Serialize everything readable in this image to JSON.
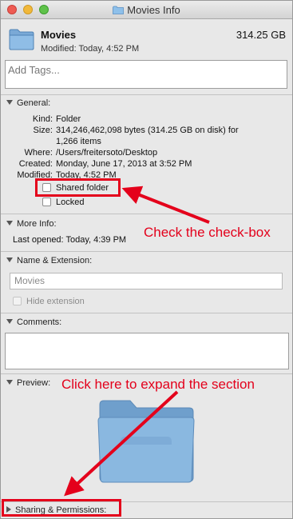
{
  "window": {
    "title": "Movies Info"
  },
  "header": {
    "name": "Movies",
    "size": "314.25 GB",
    "modified": "Modified: Today, 4:52 PM"
  },
  "tags": {
    "placeholder": "Add Tags..."
  },
  "general": {
    "heading": "General:",
    "kind_label": "Kind:",
    "kind_value": "Folder",
    "size_label": "Size:",
    "size_value_1": "314,246,462,098 bytes (314.25 GB on disk) for",
    "size_value_2": "1,266 items",
    "where_label": "Where:",
    "where_value": "/Users/freitersoto/Desktop",
    "created_label": "Created:",
    "created_value": "Monday, June 17, 2013 at 3:52 PM",
    "modified_label": "Modified:",
    "modified_value": "Today, 4:52 PM",
    "shared_folder": "Shared folder",
    "locked": "Locked"
  },
  "more_info": {
    "heading": "More Info:",
    "last_opened": "Last opened: Today, 4:39 PM"
  },
  "name_extension": {
    "heading": "Name & Extension:",
    "name_value": "Movies",
    "hide_extension": "Hide extension"
  },
  "comments": {
    "heading": "Comments:"
  },
  "preview": {
    "heading": "Preview:"
  },
  "sharing": {
    "heading": "Sharing & Permissions:"
  },
  "annotations": {
    "check_text": "Check the check-box",
    "expand_text": "Click here to expand the section",
    "color": "#e3001b"
  },
  "colors": {
    "folder_blue": "#7fb0db",
    "annotation_red": "#e4001b"
  }
}
